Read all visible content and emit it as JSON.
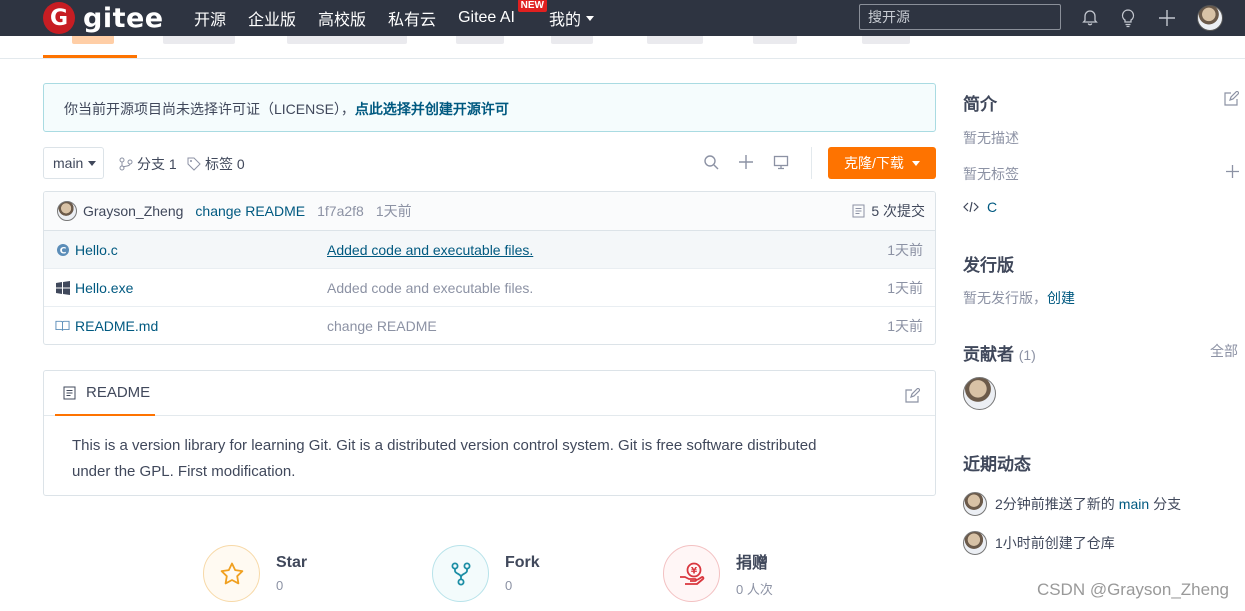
{
  "topnav": {
    "logo_text": "gitee",
    "logo_glyph": "G",
    "links": [
      "开源",
      "企业版",
      "高校版",
      "私有云",
      "Gitee AI",
      "我的"
    ],
    "new_badge": "NEW",
    "search_placeholder": "搜开源",
    "icons": [
      "bell-icon",
      "bulb-icon",
      "plus-icon"
    ],
    "colors": {
      "background": "#2e3441",
      "brand": "#c71d23"
    }
  },
  "banner": {
    "text": "你当前开源项目尚未选择许可证（LICENSE），",
    "link": "点此选择并创建开源许可"
  },
  "toolbar": {
    "branch": "main",
    "branches": "分支 1",
    "tags": "标签 0",
    "clone": "克隆/下载",
    "accent": "#fe7300"
  },
  "commit": {
    "author": "Grayson_Zheng",
    "message": "change README",
    "hash": "1f7a2f8",
    "time": "1天前",
    "count": "5 次提交"
  },
  "files": [
    {
      "name": "Hello.c",
      "message": "Added code and executable files.",
      "time": "1天前",
      "icon": "c-file-icon"
    },
    {
      "name": "Hello.exe",
      "message": "Added code and executable files.",
      "time": "1天前",
      "icon": "windows-icon"
    },
    {
      "name": "README.md",
      "message": "change README",
      "time": "1天前",
      "icon": "book-icon"
    }
  ],
  "readme": {
    "title": "README",
    "line1": "This is a version library for learning Git. Git is a distributed version control system. Git is free software distributed",
    "line2": "under the GPL. First modification."
  },
  "stats": [
    {
      "label": "Star",
      "count": "0",
      "icon": "star-icon"
    },
    {
      "label": "Fork",
      "count": "0",
      "icon": "fork-icon"
    },
    {
      "label": "捐赠",
      "count": "0 人次",
      "icon": "donate-icon"
    }
  ],
  "sidebar": {
    "intro_title": "简介",
    "no_desc": "暂无描述",
    "no_tags": "暂无标签",
    "language": "C",
    "release_title": "发行版",
    "no_release": "暂无发行版，",
    "create": "创建",
    "contrib_title": "贡献者",
    "contrib_count": "(1)",
    "all": "全部",
    "activity_title": "近期动态",
    "activity1_pre": "2分钟前推送了新的",
    "activity1_branch": "main",
    "activity1_post": "分支",
    "activity2": "1小时前创建了仓库"
  },
  "watermark": "CSDN @Grayson_Zheng"
}
